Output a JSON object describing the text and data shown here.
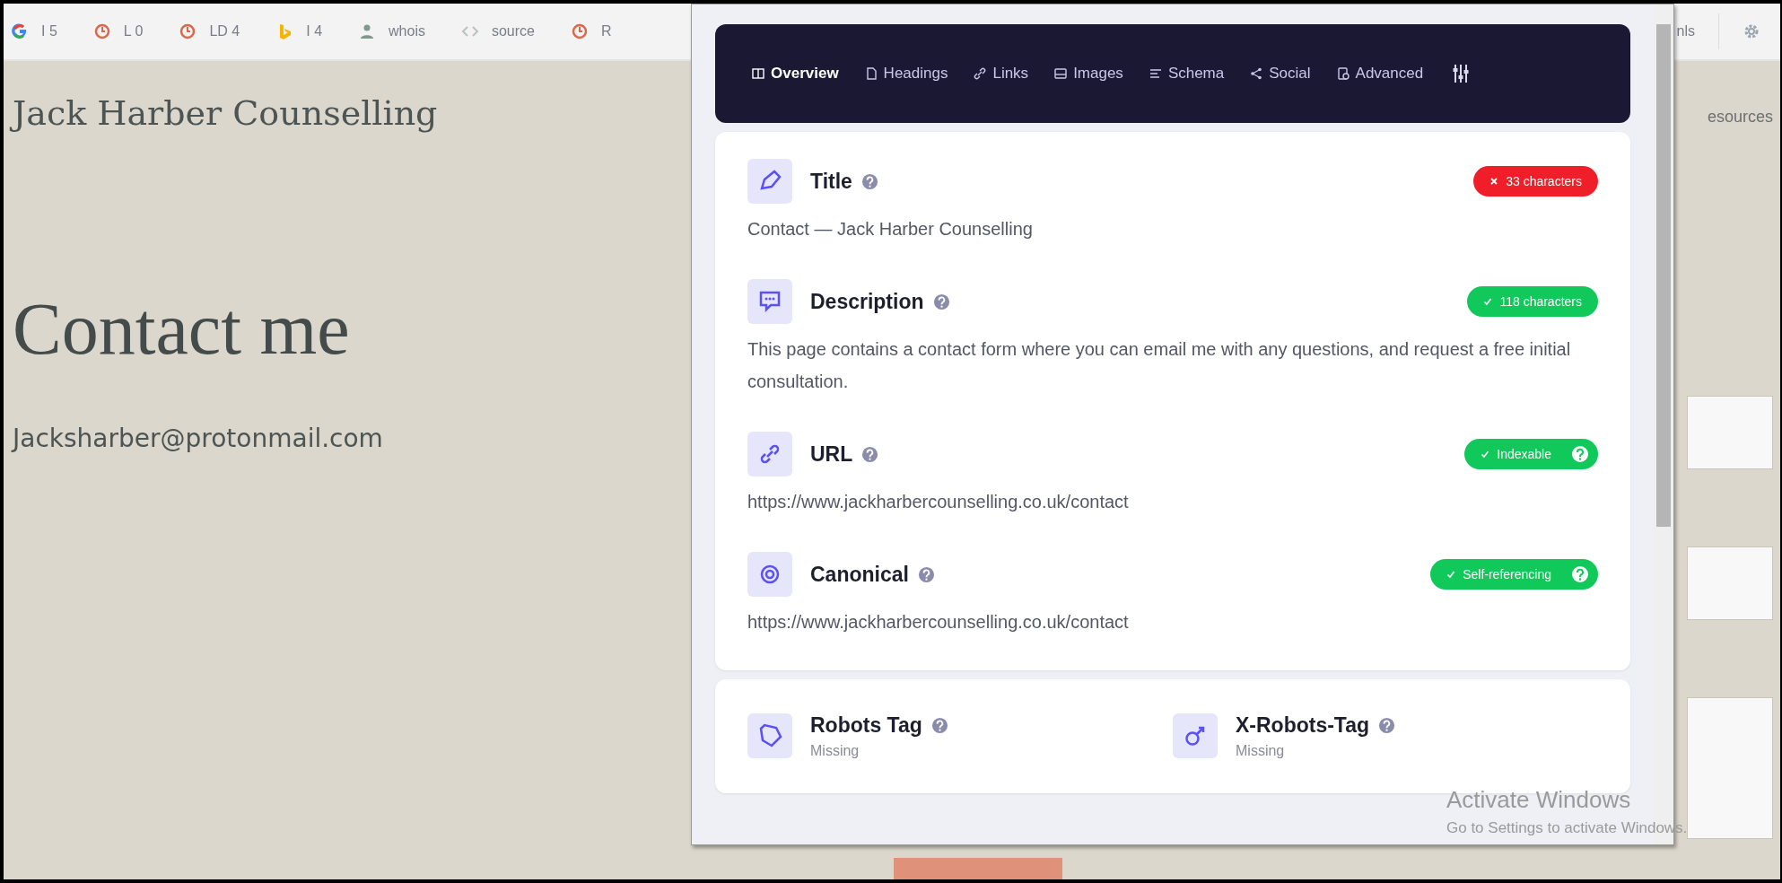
{
  "bookmarks": [
    {
      "kind": "google",
      "label": "I 5"
    },
    {
      "kind": "ring",
      "label": "L 0"
    },
    {
      "kind": "ring",
      "label": "LD 4"
    },
    {
      "kind": "bing",
      "label": "I 4"
    },
    {
      "kind": "person",
      "label": "whois"
    },
    {
      "kind": "code",
      "label": "source"
    },
    {
      "kind": "ring",
      "label": "R"
    }
  ],
  "toolbar_right": {
    "label": "nls"
  },
  "page": {
    "site_title": "Jack Harber Counselling",
    "nav_item": "esources",
    "heading": "Contact me",
    "email": "Jacksharber@protonmail.com"
  },
  "form_fields": [
    {
      "kind": "input"
    },
    {
      "kind": "input"
    },
    {
      "kind": "textarea"
    }
  ],
  "popup": {
    "tabs": [
      {
        "kind": "overview",
        "label": "Overview",
        "selected": true
      },
      {
        "kind": "headings",
        "label": "Headings",
        "selected": false
      },
      {
        "kind": "links",
        "label": "Links",
        "selected": false
      },
      {
        "kind": "images",
        "label": "Images",
        "selected": false
      },
      {
        "kind": "schema",
        "label": "Schema",
        "selected": false
      },
      {
        "kind": "social",
        "label": "Social",
        "selected": false
      },
      {
        "kind": "advanced",
        "label": "Advanced",
        "selected": false
      }
    ],
    "fields": [
      {
        "kind": "title",
        "label": "Title",
        "value": "Contact — Jack Harber Counselling",
        "badge": {
          "passed": false,
          "text": "33 characters",
          "help": false
        }
      },
      {
        "kind": "description",
        "label": "Description",
        "value": "This page contains a contact form where you can email me with any questions, and request a free initial consultation.",
        "badge": {
          "passed": true,
          "text": "118 characters",
          "help": false
        }
      },
      {
        "kind": "url",
        "label": "URL",
        "value": "https://www.jackharbercounselling.co.uk/contact",
        "badge": {
          "passed": true,
          "text": "Indexable",
          "help": true
        }
      },
      {
        "kind": "canonical",
        "label": "Canonical",
        "value": "https://www.jackharbercounselling.co.uk/contact",
        "badge": {
          "passed": true,
          "text": "Self-referencing",
          "help": true
        }
      }
    ],
    "robots": [
      {
        "kind": "tag",
        "label": "Robots Tag",
        "value": "Missing"
      },
      {
        "kind": "gender",
        "label": "X-Robots-Tag",
        "value": "Missing"
      }
    ]
  },
  "activation_notice": {
    "title": "Activate Windows",
    "subtitle": "Go to Settings to activate Windows."
  }
}
